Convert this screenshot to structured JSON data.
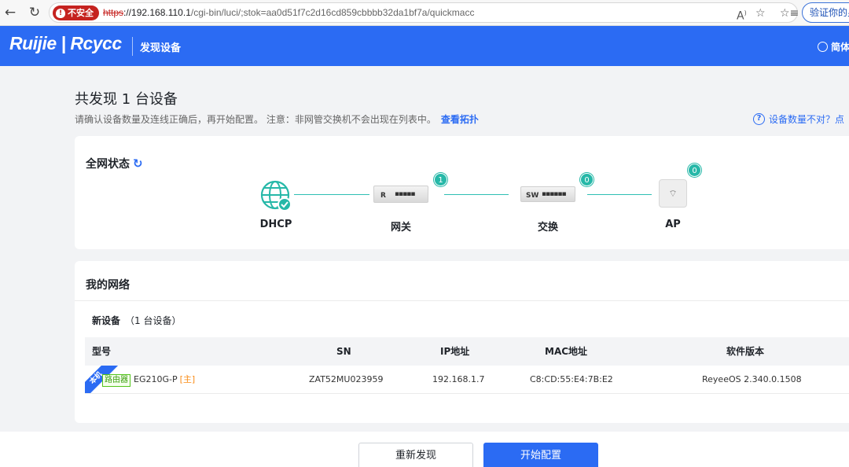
{
  "browser": {
    "insecure_label": "不安全",
    "url_scheme": "https",
    "url_host": "://192.168.110.1",
    "url_path": "/cgi-bin/luci/;stok=aa0d51f7c2d16cd859cbbbb32da1bf7a/quickmacc",
    "profile_label": "验证你的身"
  },
  "header": {
    "logo": "Ruijie | Rcycc",
    "title": "发现设备",
    "language": "简体"
  },
  "page": {
    "title": "共发现 1 台设备",
    "hint": "请确认设备数量及连线正确后，再开始配置。 注意：非网管交换机不会出现在列表中。",
    "topology_link": "查看拓扑",
    "count_help": "设备数量不对？点"
  },
  "status": {
    "title": "全网状态",
    "nodes": [
      {
        "label": "DHCP"
      },
      {
        "label": "网关",
        "count": "1",
        "device_text": "R"
      },
      {
        "label": "交换",
        "count": "0",
        "device_text": "SW"
      },
      {
        "label": "AP",
        "count": "0"
      }
    ]
  },
  "network": {
    "title": "我的网络",
    "new_devices": "新设备",
    "new_devices_count": "（1 台设备）",
    "columns": [
      "型号",
      "SN",
      "IP地址",
      "MAC地址",
      "软件版本"
    ],
    "rows": [
      {
        "ribbon": "本机",
        "type": "路由器",
        "model": "EG210G-P",
        "role": "[主]",
        "sn": "ZAT52MU023959",
        "ip": "192.168.1.7",
        "mac": "C8:CD:55:E4:7B:E2",
        "version": "ReyeeOS 2.340.0.1508"
      }
    ]
  },
  "actions": {
    "rediscover": "重新发现",
    "start": "开始配置"
  },
  "colors": {
    "brand": "#2b6bf3",
    "online": "#26b8a8",
    "insecure": "#c5221f"
  }
}
